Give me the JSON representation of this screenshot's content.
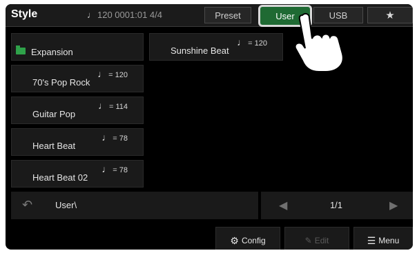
{
  "header": {
    "title": "Style",
    "tempo_text": "120  0001:01  4/4",
    "tabs": {
      "preset": "Preset",
      "user": "User",
      "usb": "USB"
    }
  },
  "folders": [
    {
      "name": "Expansion"
    }
  ],
  "styles": [
    {
      "tempo": "= 120",
      "name": "Sunshine Beat"
    },
    {
      "tempo": "= 120",
      "name": "70's Pop Rock"
    },
    {
      "tempo": "= 114",
      "name": "Guitar Pop"
    },
    {
      "tempo": "= 78",
      "name": "Heart Beat"
    },
    {
      "tempo": "= 78",
      "name": "Heart Beat 02"
    }
  ],
  "path": {
    "label": "User\\"
  },
  "pager": {
    "page": "1/1"
  },
  "buttons": {
    "config": "Config",
    "edit": "Edit",
    "menu": "Menu"
  },
  "colors": {
    "selected_tab": "#1f6a33",
    "folder": "#2fa24a"
  },
  "icons": {
    "back": "undo-arrow-icon",
    "prev": "triangle-left-icon",
    "next": "triangle-right-icon",
    "favorite": "star-icon",
    "config": "gear-icon",
    "edit": "edit-icon",
    "menu": "hamburger-icon",
    "overlay": "pointing-hand-icon"
  }
}
